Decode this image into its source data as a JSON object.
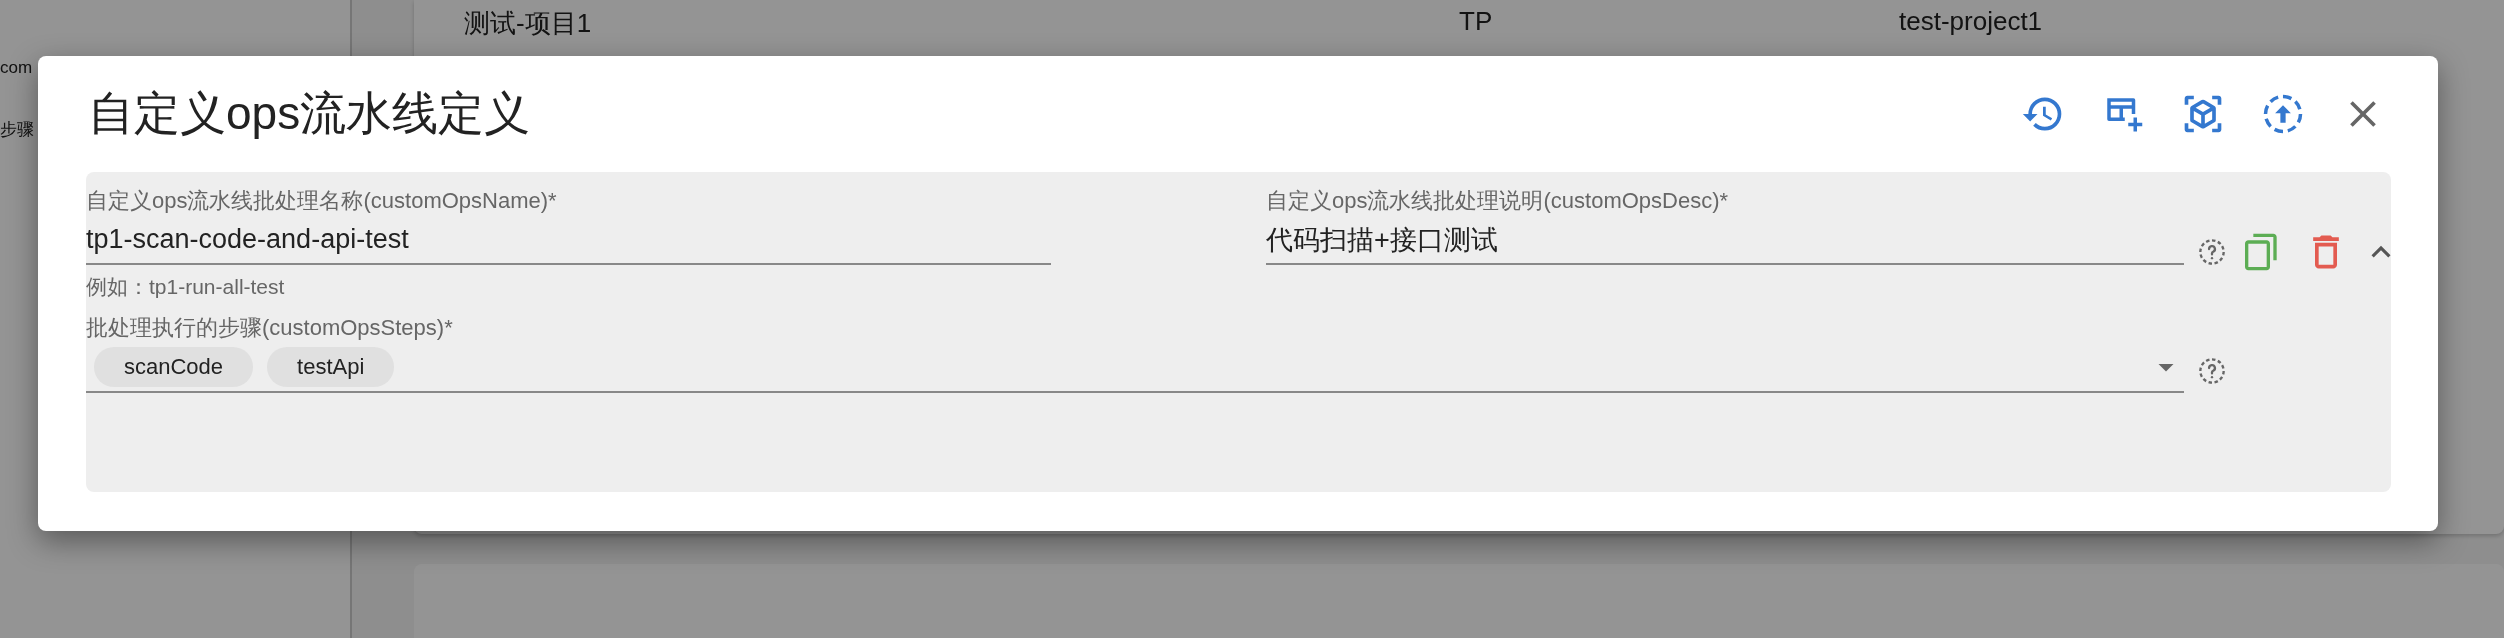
{
  "background": {
    "sidebar_items": [
      "com",
      "步骤"
    ],
    "table_row": [
      "测试-项目1",
      "TP",
      "test-project1"
    ]
  },
  "dialog": {
    "title": "自定义ops流水线定义",
    "fields": [
      {
        "label": "自定义ops流水线批处理名称(customOpsName)*",
        "value": "tp1-scan-code-and-api-test",
        "helper": "例如：tp1-run-all-test"
      },
      {
        "label": "自定义ops流水线批处理说明(customOpsDesc)*",
        "value": "代码扫描+接口测试"
      }
    ],
    "expanded": true,
    "steps": {
      "label": "批处理执行的步骤(customOpsSteps)*",
      "chips": [
        "scanCode",
        "testApi"
      ]
    }
  }
}
